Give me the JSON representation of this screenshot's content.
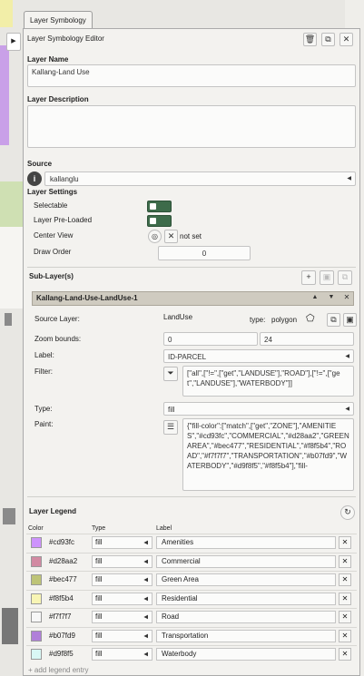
{
  "tab": {
    "label": "Layer Symbology"
  },
  "header": {
    "title": "Layer Symbology Editor"
  },
  "layer_name": {
    "label": "Layer Name",
    "value": "Kallang-Land Use"
  },
  "layer_description": {
    "label": "Layer Description",
    "value": ""
  },
  "source": {
    "label": "Source",
    "value": "kallanglu"
  },
  "layer_settings": {
    "label": "Layer Settings",
    "selectable_label": "Selectable",
    "preloaded_label": "Layer Pre-Loaded",
    "center_view_label": "Center View",
    "center_view_value": "not set",
    "draw_order_label": "Draw Order",
    "draw_order_value": "0"
  },
  "sub_layers": {
    "label": "Sub-Layer(s)",
    "item": {
      "name": "Kallang-Land-Use-LandUse-1",
      "source_layer_label": "Source Layer:",
      "source_layer_value": "LandUse",
      "type_label": "type:",
      "type_value": "polygon",
      "zoom_label": "Zoom bounds:",
      "zoom_min": "0",
      "zoom_max": "24",
      "label_label": "Label:",
      "label_value": "ID-PARCEL",
      "filter_label": "Filter:",
      "filter_value": "[\"all\",[\"!=\",[\"get\",\"LANDUSE\"],\"ROAD\"],[\"!=\",[\"get\",\"LANDUSE\"],\"WATERBODY\"]]",
      "type_row_label": "Type:",
      "type_row_value": "fill",
      "paint_label": "Paint:",
      "paint_value": "{\"fill-color\":[\"match\",[\"get\",\"ZONE\"],\"AMENITIES\",\"#cd93fc\",\"COMMERCIAL\",\"#d28aa2\",\"GREEN AREA\",\"#bec477\",\"RESIDENTIAL\",\"#f8f5b4\",\"ROAD\",\"#f7f7f7\",\"TRANSPORTATION\",\"#b07fd9\",\"WATERBODY\",\"#d9f8f5\",\"#f8f5b4\"],\"fill-"
    }
  },
  "legend": {
    "title": "Layer Legend",
    "col_color": "Color",
    "col_type": "Type",
    "col_label": "Label",
    "rows": [
      {
        "color": "#cd93fc",
        "type": "fill",
        "label": "Amenities"
      },
      {
        "color": "#d28aa2",
        "type": "fill",
        "label": "Commercial"
      },
      {
        "color": "#bec477",
        "type": "fill",
        "label": "Green Area"
      },
      {
        "color": "#f8f5b4",
        "type": "fill",
        "label": "Residential"
      },
      {
        "color": "#f7f7f7",
        "type": "fill",
        "label": "Road"
      },
      {
        "color": "#b07fd9",
        "type": "fill",
        "label": "Transportation"
      },
      {
        "color": "#d9f8f5",
        "type": "fill",
        "label": "Waterbody"
      }
    ],
    "add_label": "+ add legend entry"
  }
}
